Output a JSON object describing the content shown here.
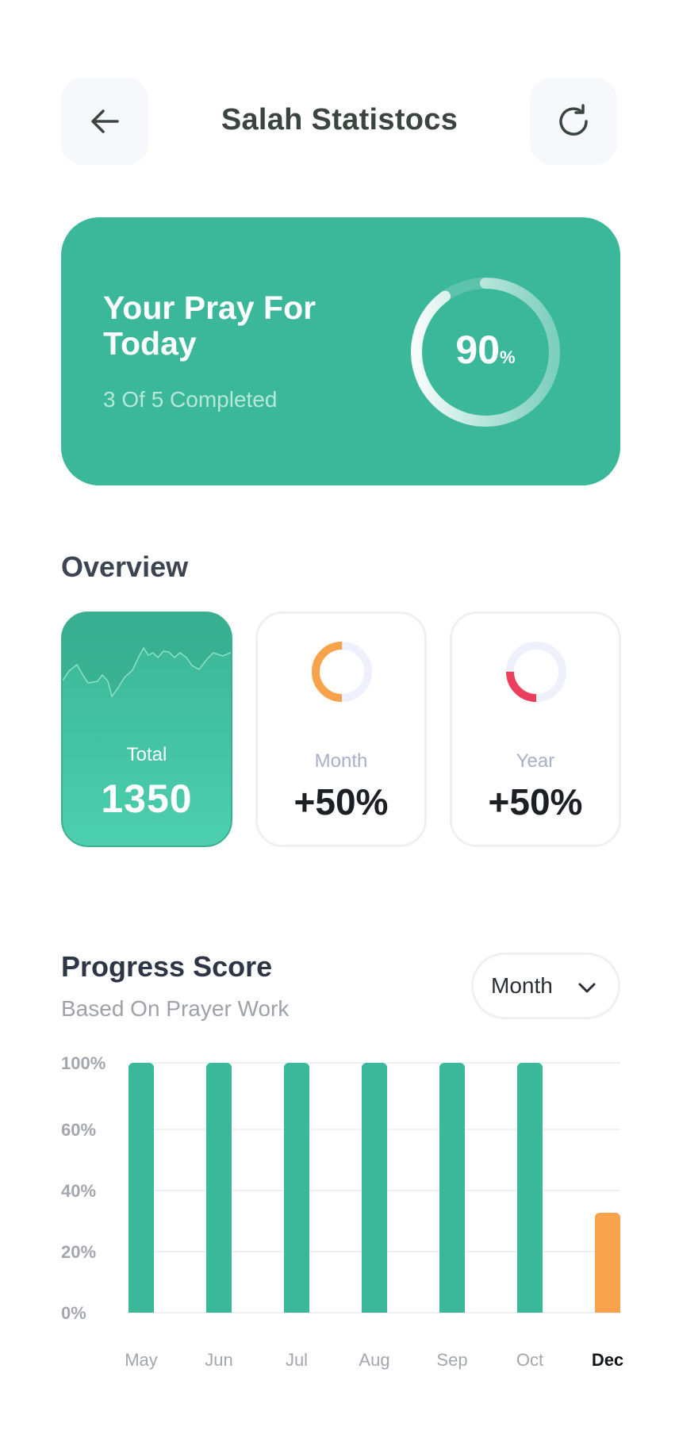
{
  "header": {
    "title": "Salah Statistocs",
    "back_icon": "arrow-left-icon",
    "refresh_icon": "refresh-icon"
  },
  "today": {
    "title": "Your Pray For Today",
    "subtitle": "3 Of 5 Completed",
    "percent_value": "90",
    "percent_sign": "%",
    "progress_fraction": 0.9
  },
  "overview": {
    "title": "Overview",
    "total": {
      "label": "Total",
      "value": "1350"
    },
    "month": {
      "label": "Month",
      "value": "+50%",
      "ring_fraction": 0.5,
      "ring_color": "#f8a24b"
    },
    "year": {
      "label": "Year",
      "value": "+50%",
      "ring_fraction": 0.25,
      "ring_color": "#ec3f5e"
    }
  },
  "progress": {
    "title": "Progress Score",
    "subtitle": "Based On Prayer Work",
    "period": "Month",
    "period_icon": "chevron-down-icon"
  },
  "colors": {
    "accent": "#3ab899",
    "highlight": "#f8a24b",
    "ring_track": "#eef0fb"
  },
  "chart_data": {
    "type": "bar",
    "categories": [
      "May",
      "Jun",
      "Jul",
      "Aug",
      "Sep",
      "Oct",
      "Dec"
    ],
    "values": [
      100,
      100,
      100,
      100,
      100,
      100,
      40
    ],
    "highlight_index": 6,
    "y_ticks": [
      "0%",
      "20%",
      "40%",
      "60%",
      "100%"
    ],
    "ylim": [
      0,
      100
    ],
    "grid": true
  }
}
